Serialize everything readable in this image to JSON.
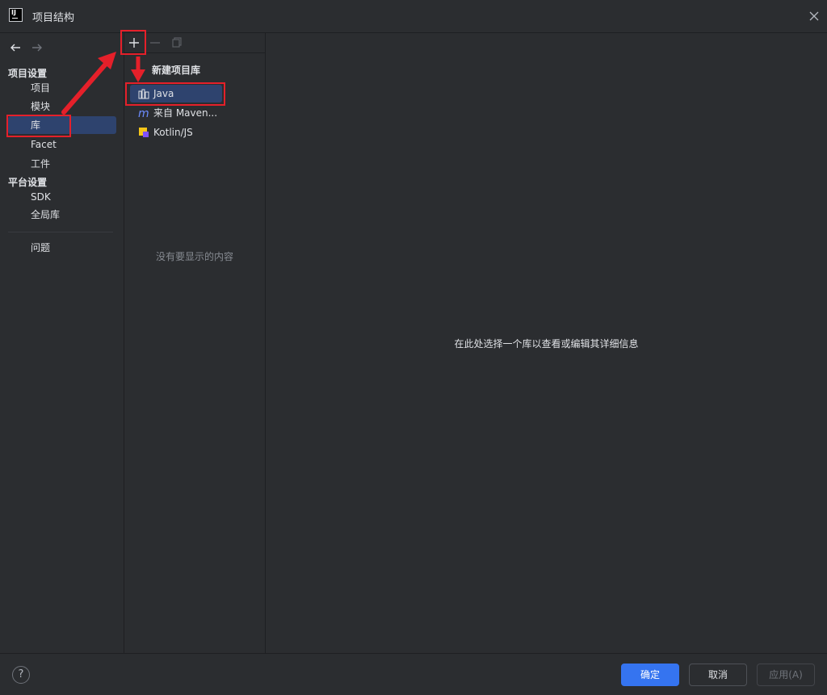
{
  "window": {
    "title": "项目结构",
    "close_icon": "close-icon"
  },
  "colors": {
    "accent": "#3574f0",
    "selection": "#2e436e",
    "annotation": "#e5202a",
    "background": "#2b2d30"
  },
  "sidebar": {
    "back_icon": "arrow-left-icon",
    "forward_icon": "arrow-right-icon",
    "groups": [
      {
        "title": "项目设置",
        "items": [
          "项目",
          "模块",
          "库",
          "Facet",
          "工件"
        ]
      },
      {
        "title": "平台设置",
        "items": [
          "SDK",
          "全局库"
        ]
      }
    ],
    "problems": "问题",
    "selected_item": "库"
  },
  "middle": {
    "toolbar": {
      "add_icon": "plus-icon",
      "remove_icon": "minus-icon",
      "copy_icon": "copy-icon"
    },
    "empty_text": "没有要显示的内容"
  },
  "new_library_popup": {
    "title": "新建项目库",
    "items": [
      {
        "label": "Java",
        "icon": "java-library-icon"
      },
      {
        "label": "来自 Maven...",
        "icon": "maven-icon"
      },
      {
        "label": "Kotlin/JS",
        "icon": "kotlin-js-icon"
      }
    ],
    "selected_item": "Java"
  },
  "main": {
    "hint": "在此处选择一个库以查看或编辑其详细信息"
  },
  "footer": {
    "help_label": "?",
    "ok_label": "确定",
    "cancel_label": "取消",
    "apply_label": "应用(A)"
  }
}
